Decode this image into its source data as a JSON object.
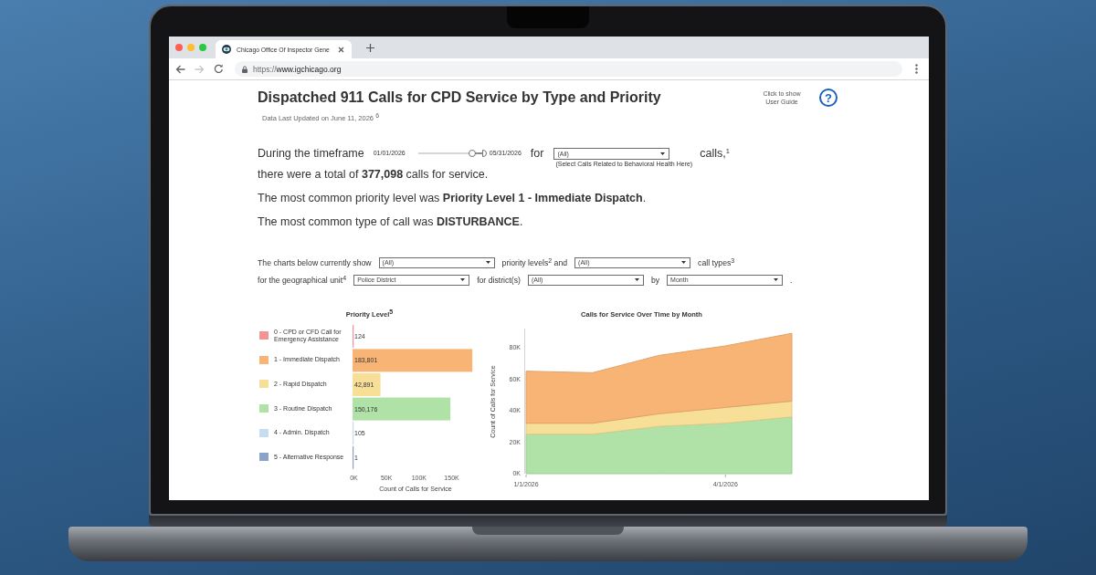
{
  "browser": {
    "tabs": [
      {
        "title": "Chicago Office Of Inspector Gene",
        "selected": true
      }
    ],
    "back": {
      "disabled": false
    },
    "forward": {
      "disabled": true
    },
    "url_scheme": "https://",
    "url_host": "www.igchicago.org"
  },
  "header": {
    "title": "Dispatched 911 Calls for CPD Service by Type and Priority",
    "guide_hint": "Click to show User Guide",
    "help_button": "?",
    "updated": "Data Last Updated on June 11, 2026 $^{6}$"
  },
  "summary": {
    "timeframe": {
      "lead": "During the timeframe",
      "start_date": "01/01/2026",
      "slider": {
        "handles": [
          {
            "level": 0.79
          },
          {
            "level": 1
          }
        ]
      },
      "end_date": "05/31/2026",
      "for_label": "for",
      "dropdown": {
        "value": "(All)",
        "caption": "(Select Calls Related to Behavioral Health Here)"
      },
      "tail": "calls,$^{1}$"
    },
    "sentences": [
      "there were a total of **377,098** calls for service.",
      "The most common priority level was **Priority Level 1 - Immediate Dispatch**.",
      "The most common type of call was **DISTURBANCE**."
    ]
  },
  "filter_rows": [
    [
      {
        "kind": "text",
        "text": "The charts below currently show"
      },
      {
        "kind": "dropdown",
        "value": "(All)"
      },
      {
        "kind": "text",
        "text": "priority levels$^{2}$ and"
      },
      {
        "kind": "dropdown",
        "value": "(All)"
      },
      {
        "kind": "text",
        "text": "call types$^{3}$"
      }
    ],
    [
      {
        "kind": "text",
        "text": "for the geographical unit$^{4}$"
      },
      {
        "kind": "dropdown",
        "value": "Police District"
      },
      {
        "kind": "text",
        "text": "for district(s)"
      },
      {
        "kind": "dropdown",
        "value": "(All)"
      },
      {
        "kind": "text",
        "text": "by"
      },
      {
        "kind": "dropdown",
        "value": "Month"
      },
      {
        "kind": "text",
        "text": "."
      }
    ]
  ],
  "charts": {
    "priority_level": {
      "chart_data": {
        "type": "bar",
        "orientation": "horizontal",
        "title": "Priority Level$^{5}$",
        "xlabel": "Count of Calls for Service",
        "categories": [
          "0 - CPD or CFD Call for Emergency Assistance",
          "1 - Immediate Dispatch",
          "2 - Rapid Dispatch",
          "3 - Routine Dispatch",
          "4 - Admin. Dispatch",
          "5 - Alternative Response"
        ],
        "values": [
          124,
          183801,
          42891,
          150176,
          105,
          1
        ],
        "colors": [
          "#f29494",
          "#f8b474",
          "#f7df98",
          "#b0e2a8",
          "#c6ddf1",
          "#8ba3c6"
        ],
        "value_labels": [
          "124",
          "183,801",
          "42,891",
          "150,176",
          "105",
          "1"
        ],
        "xlim": [
          0,
          185000
        ],
        "xticks": [
          {
            "value": 0,
            "label": "0K"
          },
          {
            "value": 50000,
            "label": "50K"
          },
          {
            "value": 100000,
            "label": "100K"
          },
          {
            "value": 150000,
            "label": "150K"
          }
        ]
      }
    },
    "over_time": {
      "chart_data": {
        "type": "area",
        "stacked": true,
        "title": "Calls for Service Over Time by Month",
        "ylabel": "Count of Calls for Service",
        "categories": [
          "1/1/2026",
          null,
          null,
          "4/1/2026",
          null
        ],
        "ylim": [
          0,
          92000
        ],
        "yticks": [
          {
            "value": 0,
            "label": "0K"
          },
          {
            "value": 20000,
            "label": "20K"
          },
          {
            "value": 40000,
            "label": "40K"
          },
          {
            "value": 60000,
            "label": "60K"
          },
          {
            "value": 80000,
            "label": "80K"
          }
        ],
        "series": [
          {
            "color": "#f8b474",
            "values": [
              33000,
              32000,
              37000,
              39000,
              43000
            ]
          },
          {
            "color": "#f7df98",
            "values": [
              7000,
              7000,
              8000,
              10000,
              10000
            ]
          },
          {
            "color": "#b0e2a8",
            "values": [
              25000,
              25000,
              30000,
              32000,
              36000
            ]
          }
        ]
      }
    }
  }
}
